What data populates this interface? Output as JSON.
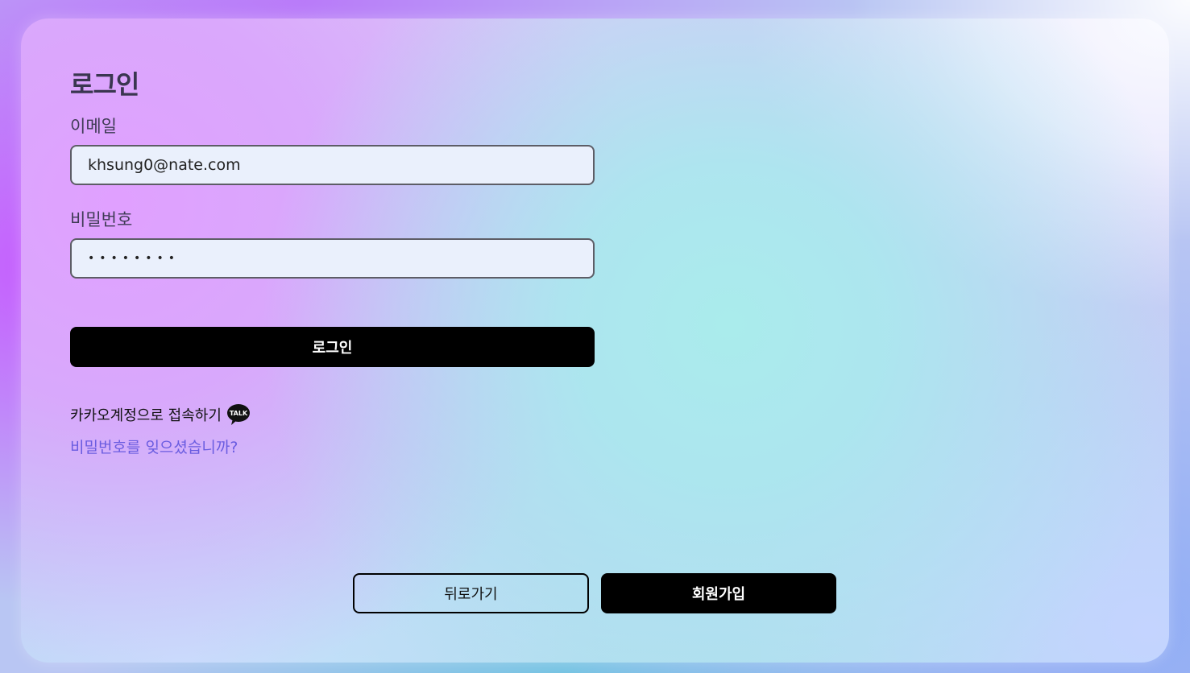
{
  "login_form": {
    "title": "로그인",
    "email_label": "이메일",
    "email_value": "khsung0@nate.com",
    "password_label": "비밀번호",
    "password_value": "••••••••",
    "login_button": "로그인",
    "kakao_text": "카카오계정으로 접속하기",
    "kakao_icon": "kakao-talk-icon",
    "forgot_link": "비밀번호를 잊으셨습니까?"
  },
  "footer": {
    "back_button": "뒤로가기",
    "signup_button": "회원가입"
  }
}
